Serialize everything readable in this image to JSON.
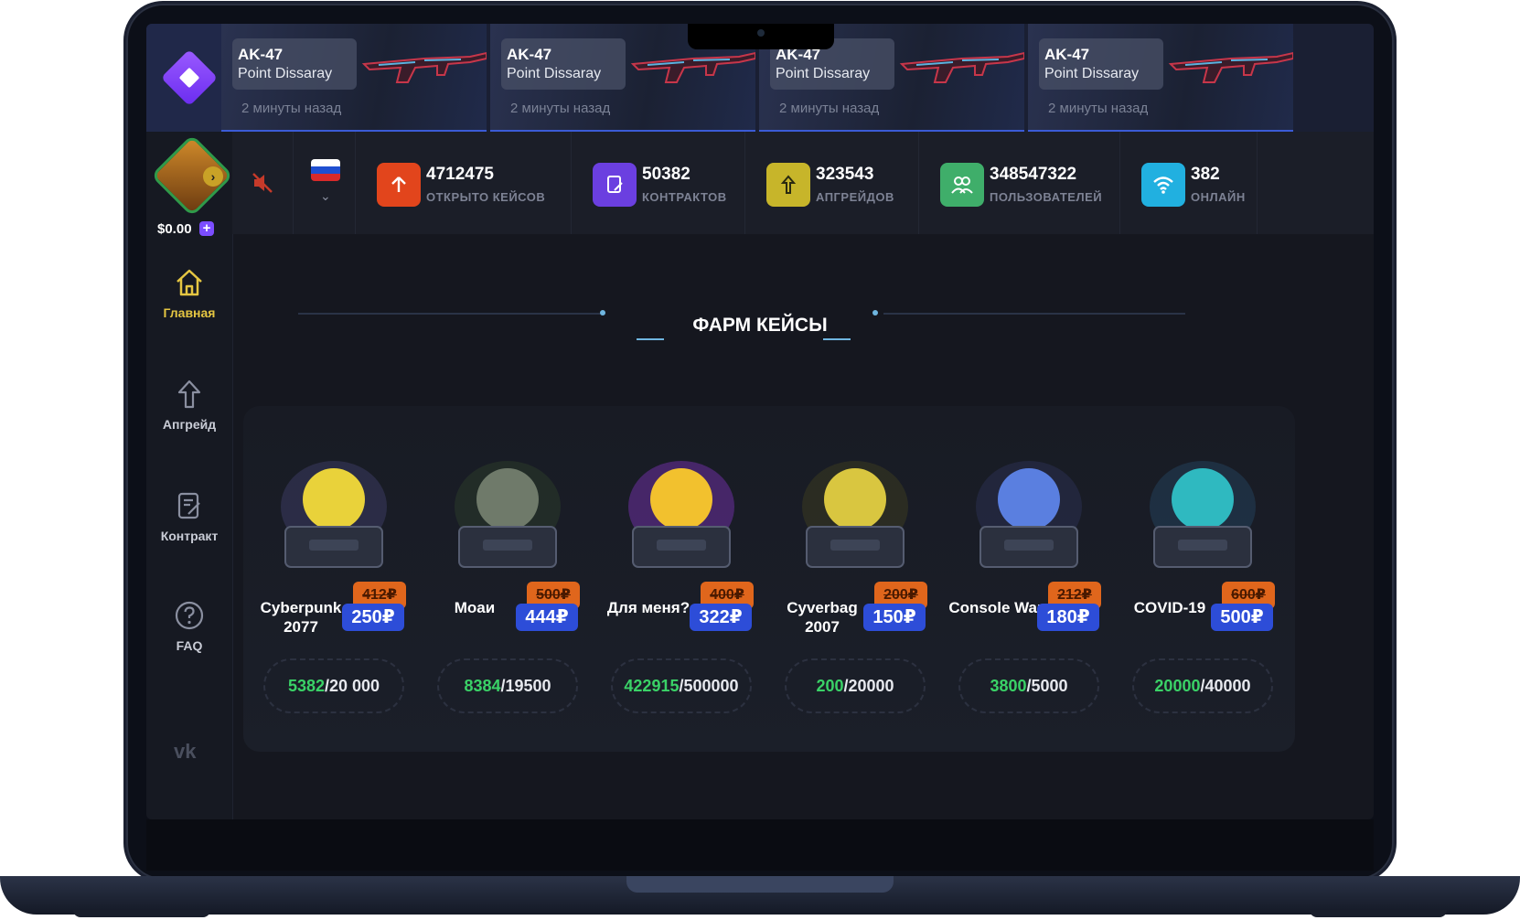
{
  "drops": [
    {
      "weapon": "AK-47",
      "skin": "Point Dissaray",
      "time": "2 минуты назад"
    },
    {
      "weapon": "AK-47",
      "skin": "Point Dissaray",
      "time": "2 минуты назад"
    },
    {
      "weapon": "AK-47",
      "skin": "Point Dissaray",
      "time": "2 минуты назад"
    },
    {
      "weapon": "AK-47",
      "skin": "Point Dissaray",
      "time": "2 минуты назад"
    }
  ],
  "user": {
    "balance": "$0.00"
  },
  "nav": {
    "home": "Главная",
    "upgrade": "Апгрейд",
    "contract": "Контракт",
    "faq": "FAQ"
  },
  "stats": [
    {
      "value": "4712475",
      "label": "ОТКРЫТО КЕЙСОВ",
      "color": "#e2451c"
    },
    {
      "value": "50382",
      "label": "КОНТРАКТОВ",
      "color": "#6b3fe0"
    },
    {
      "value": "323543",
      "label": "АПГРЕЙДОВ",
      "color": "#c7b52a"
    },
    {
      "value": "348547322",
      "label": "ПОЛЬЗОВАТЕЛЕЙ",
      "color": "#3fae6a"
    },
    {
      "value": "382",
      "label": "ОНЛАЙН",
      "color": "#21b0e0"
    }
  ],
  "section_title": "ФАРМ КЕЙСЫ",
  "cases": [
    {
      "name": "Cyberpunk 2077",
      "old_price": "412₽",
      "price": "250₽",
      "progress_done": "5382",
      "progress_total": "20 000"
    },
    {
      "name": "Моаи",
      "old_price": "500₽",
      "price": "444₽",
      "progress_done": "8384",
      "progress_total": "19500"
    },
    {
      "name": "Для меня?",
      "old_price": "400₽",
      "price": "322₽",
      "progress_done": "422915",
      "progress_total": "500000"
    },
    {
      "name": "Cyverbag 2007",
      "old_price": "200₽",
      "price": "150₽",
      "progress_done": "200",
      "progress_total": "20000"
    },
    {
      "name": "Console War",
      "old_price": "212₽",
      "price": "180₽",
      "progress_done": "3800",
      "progress_total": "5000"
    },
    {
      "name": "COVID-19",
      "old_price": "600₽",
      "price": "500₽",
      "progress_done": "20000",
      "progress_total": "40000"
    }
  ]
}
